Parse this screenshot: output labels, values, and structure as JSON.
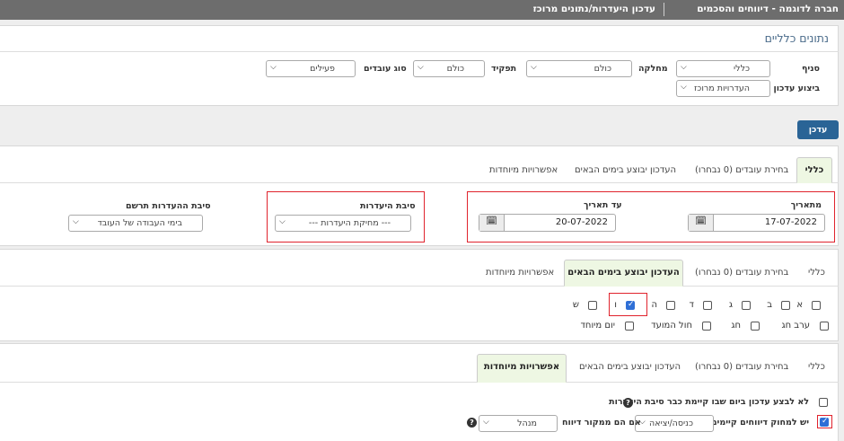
{
  "header": {
    "title": "חברה לדוגמה - דיווחים והסכמים",
    "subtitle": "עדכון היעדרות/נתונים מרוכז"
  },
  "general": {
    "title": "נתונים כלליים",
    "branch_label": "סניף",
    "branch_value": "כללי",
    "department_label": "מחלקה",
    "department_value": "כולם",
    "role_label": "תפקיד",
    "role_value": "כולם",
    "employee_type_label": "סוג עובדים",
    "employee_type_value": "פעילים",
    "update_exec_label": "ביצוע עדכון",
    "update_exec_value": "העדרויות מרוכז"
  },
  "update_button": "עדכן",
  "tabs": {
    "general": "כללי",
    "employees": "בחירת עובדים (0 נבחרו)",
    "next_days": "העדכון יבוצע בימים הבאים",
    "special": "אפשרויות מיוחדות"
  },
  "section1": {
    "from_label": "מתאריך",
    "from_value": "17-07-2022",
    "to_label": "עד תאריך",
    "to_value": "20-07-2022",
    "absence_reason_label": "סיבת היעדרות",
    "absence_reason_value": "--- מחיקת היעדרות ---",
    "recorded_reason_label": "סיבת ההעדרות תרשם",
    "recorded_reason_value": "בימי העבודה של העובד"
  },
  "days": [
    {
      "label": "א",
      "checked": false
    },
    {
      "label": "ב",
      "checked": false
    },
    {
      "label": "ג",
      "checked": false
    },
    {
      "label": "ד",
      "checked": false
    },
    {
      "label": "ה",
      "checked": false
    },
    {
      "label": "ו",
      "checked": true
    },
    {
      "label": "ש",
      "checked": false
    }
  ],
  "holidays": [
    {
      "label": "ערב חג",
      "checked": false
    },
    {
      "label": "חג",
      "checked": false
    },
    {
      "label": "חול המועד",
      "checked": false
    },
    {
      "label": "יום מיוחד",
      "checked": false
    }
  ],
  "special": {
    "opt1_label": "לא לבצע עדכון ביום שבו קיימת כבר סיבת היעדרות",
    "opt1_checked": false,
    "opt2_label": "יש למחוק דיווחים קיימים של",
    "opt2_checked": true,
    "opt2_select": "כניסה/יציאה",
    "source_label": "אם הם ממקור דיווח",
    "source_select": "מנהל"
  },
  "icons": {
    "calendar": "calendar-icon",
    "chevron": "chevron-down-icon",
    "help": "help-icon"
  }
}
